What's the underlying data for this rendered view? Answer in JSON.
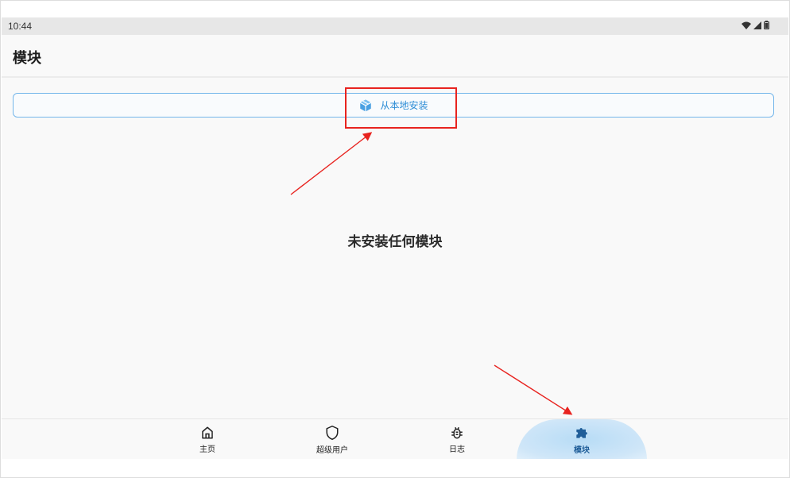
{
  "status_bar": {
    "time": "10:44",
    "icons": [
      "wifi-icon",
      "signal-icon",
      "battery-icon"
    ]
  },
  "app_bar": {
    "title": "模块"
  },
  "install_button": {
    "label": "从本地安装",
    "icon": "package-icon"
  },
  "empty_state": {
    "text": "未安装任何模块"
  },
  "bottom_nav": {
    "items": [
      {
        "label": "主页",
        "icon": "home-icon",
        "active": false
      },
      {
        "label": "超级用户",
        "icon": "shield-icon",
        "active": false
      },
      {
        "label": "日志",
        "icon": "bug-icon",
        "active": false
      },
      {
        "label": "模块",
        "icon": "puzzle-icon",
        "active": true
      }
    ]
  },
  "colors": {
    "accent": "#2f8ed6",
    "active_nav": "#1f5e99",
    "annotation": "#e8231f",
    "background": "#f9f9f9"
  }
}
